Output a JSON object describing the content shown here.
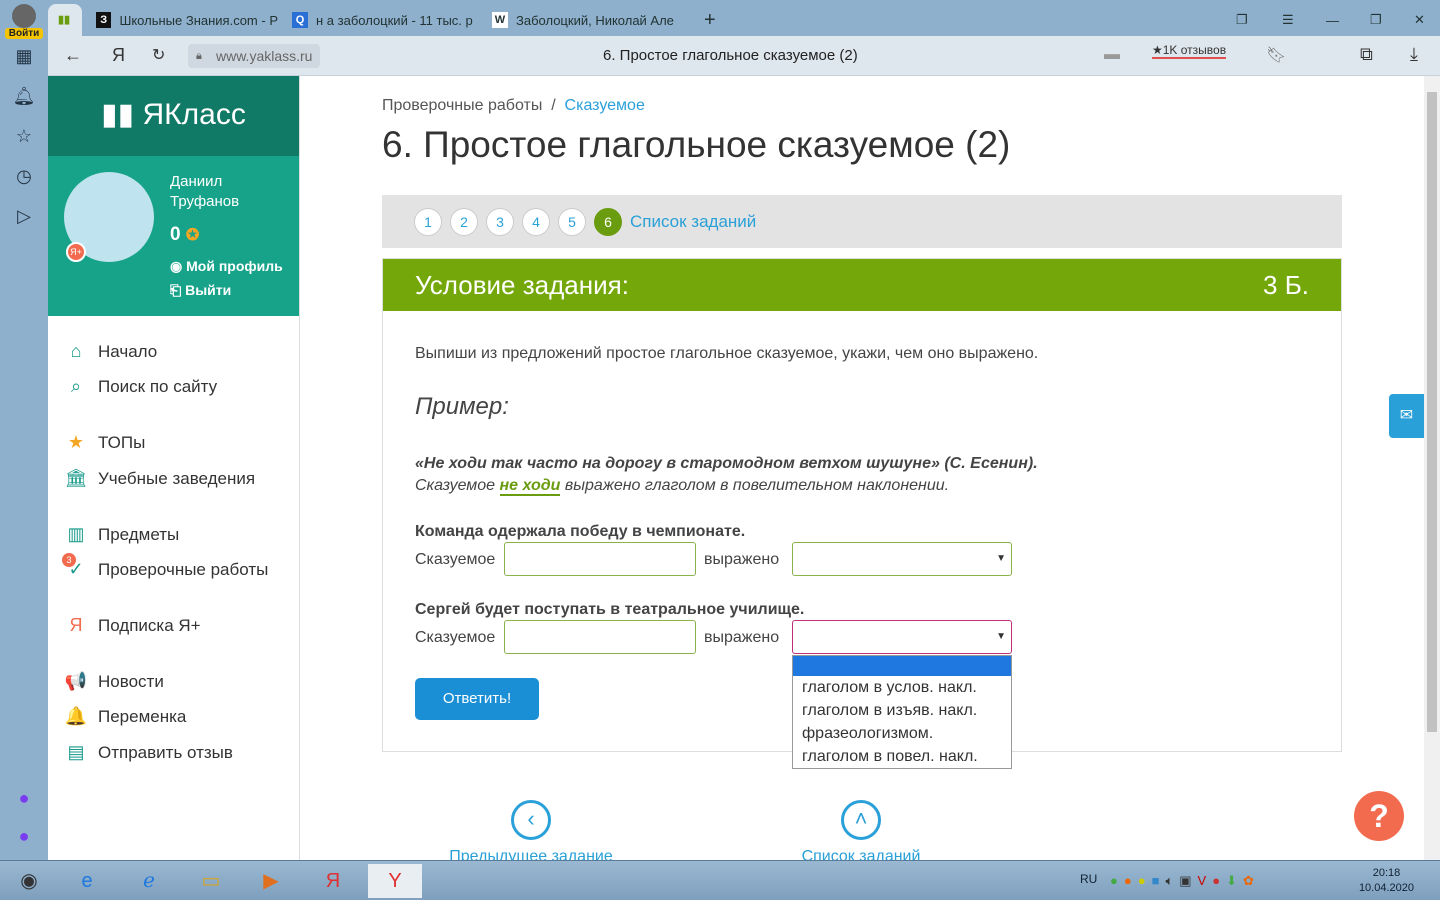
{
  "browser": {
    "login_label": "Войти",
    "tabs": [
      {
        "title": "Школьные Знания.com - Р",
        "icon": "З"
      },
      {
        "title": "н а заболоцкий - 11 тыс. р",
        "icon": "Q"
      },
      {
        "title": "Заболоцкий, Николай Але",
        "icon": "W"
      }
    ],
    "url": "www.yaklass.ru",
    "page_title": "6. Простое глагольное сказуемое (2)",
    "reviews": "★1K отзывов"
  },
  "sidebar": {
    "logo": "ЯКласс",
    "user_name": "Даниил Труфанов",
    "points": "0",
    "my_profile": "Мой профиль",
    "logout": "Выйти",
    "badge": "3",
    "items": [
      {
        "label": "Начало",
        "icon": "⌂"
      },
      {
        "label": "Поиск по сайту",
        "icon": "⌕"
      },
      {
        "label": "ТОПы",
        "icon": "★"
      },
      {
        "label": "Учебные заведения",
        "icon": "🏛"
      },
      {
        "label": "Предметы",
        "icon": "▥"
      },
      {
        "label": "Проверочные работы",
        "icon": "✓"
      },
      {
        "label": "Подписка Я+",
        "icon": "Я"
      },
      {
        "label": "Новости",
        "icon": "📢"
      },
      {
        "label": "Переменка",
        "icon": "🔔"
      },
      {
        "label": "Отправить отзыв",
        "icon": "▤"
      }
    ]
  },
  "main": {
    "breadcrumb": [
      "Проверочные работы",
      "Сказуемое"
    ],
    "title": "6. Простое глагольное сказуемое (2)",
    "steps": [
      "1",
      "2",
      "3",
      "4",
      "5",
      "6"
    ],
    "task_list_link": "Список заданий",
    "task_header": "Условие задания:",
    "score": "3 Б.",
    "instruction": "Выпиши из предложений простое глагольное сказуемое, укажи, чем оно выражено.",
    "example_title": "Пример:",
    "example_quote": "«Не ходи так часто на дорогу в старомодном ветхом шушуне» (С. Есенин).",
    "example_pre": "Сказуемое ",
    "example_word": "не ходи",
    "example_post": " выражено глаголом в повелительном наклонении.",
    "q1": "Команда одержала победу в чемпионате.",
    "q2": "Сергей будет поступать в театральное училище.",
    "pred_label": "Сказуемое",
    "expr_label": "выражено",
    "options": [
      "",
      "глаголом в услов. накл.",
      "глаголом в изъяв. накл.",
      "фразеологизмом.",
      "глаголом в повел. накл."
    ],
    "submit": "Ответить!",
    "prev": "Предыдущее задание",
    "list": "Список заданий"
  },
  "taskbar": {
    "lang": "RU",
    "time": "20:18",
    "date": "10.04.2020"
  }
}
